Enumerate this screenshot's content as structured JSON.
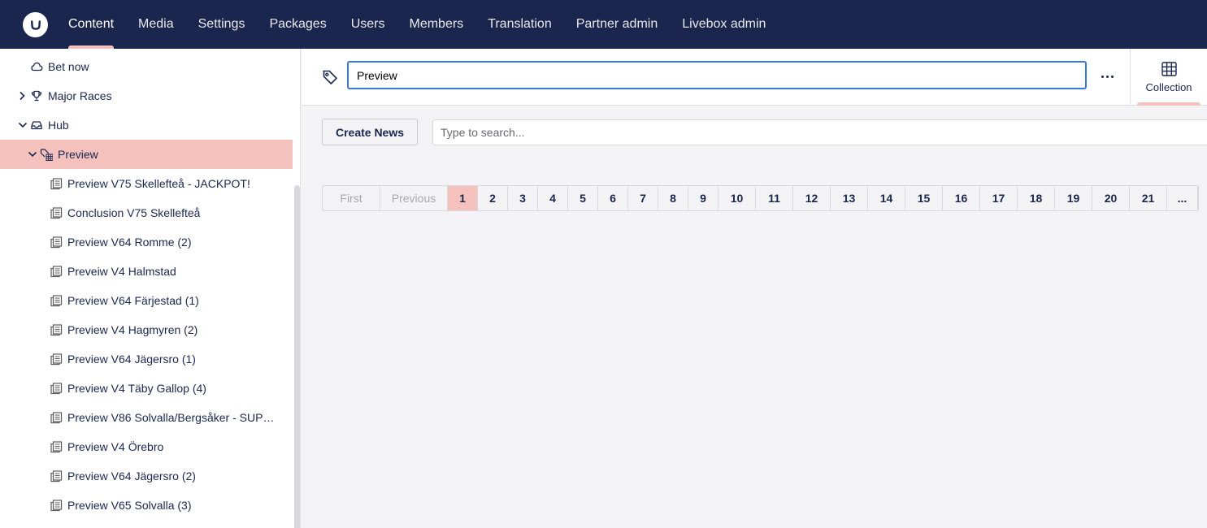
{
  "topnav": {
    "items": [
      {
        "label": "Content",
        "active": true
      },
      {
        "label": "Media"
      },
      {
        "label": "Settings"
      },
      {
        "label": "Packages"
      },
      {
        "label": "Users"
      },
      {
        "label": "Members"
      },
      {
        "label": "Translation"
      },
      {
        "label": "Partner admin"
      },
      {
        "label": "Livebox admin"
      }
    ]
  },
  "tree": {
    "top_items": [
      {
        "label": "Bet now",
        "icon": "cloud-icon"
      },
      {
        "label": "Major Races",
        "icon": "trophy-icon"
      },
      {
        "label": "Hub",
        "icon": "inbox-icon"
      },
      {
        "label": "Preview",
        "icon": "tag-grid-icon"
      }
    ],
    "children": [
      "Preview V75 Skellefteå - JACKPOT!",
      "Conclusion V75 Skellefteå",
      "Preview V64 Romme (2)",
      "Preveiw V4 Halmstad",
      "Preview V64 Färjestad (1)",
      "Preview V4 Hagmyren (2)",
      "Preview V64 Jägersro (1)",
      "Preview V4 Täby Gallop (4)",
      "Preview V86 Solvalla/Bergsåker - SUPER…",
      "Preview V4 Örebro",
      "Preview V64 Jägersro (2)",
      "Preview V65 Solvalla (3)"
    ]
  },
  "editor": {
    "name_value": "Preview",
    "app_tab_label": "Collection"
  },
  "toolbar": {
    "create_label": "Create News",
    "search_placeholder": "Type to search..."
  },
  "pagination": {
    "first": "First",
    "previous": "Previous",
    "pages": [
      "1",
      "2",
      "3",
      "4",
      "5",
      "6",
      "7",
      "8",
      "9",
      "10",
      "11",
      "12",
      "13",
      "14",
      "15",
      "16",
      "17",
      "18",
      "19",
      "20",
      "21"
    ],
    "current": "1",
    "ellipsis": "..."
  },
  "colors": {
    "navbar": "#1b264f",
    "accent": "#f5c1bc",
    "focus": "#3879d9"
  }
}
